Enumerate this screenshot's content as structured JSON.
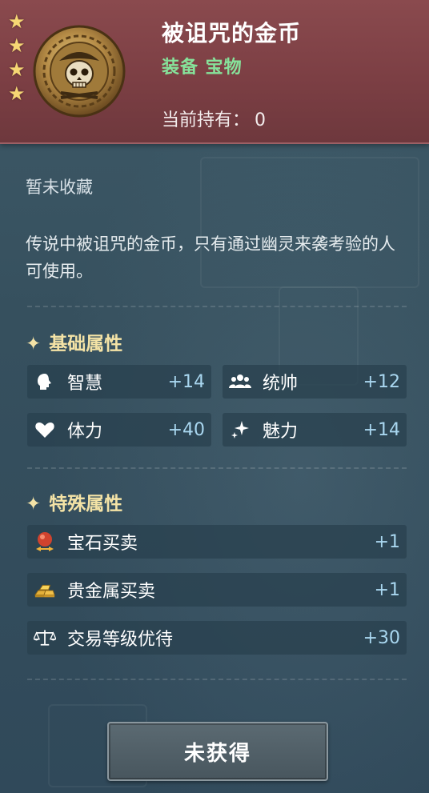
{
  "item": {
    "name": "被诅咒的金币",
    "category": "装备 宝物",
    "owned_label": "当前持有：",
    "owned_count": "0",
    "rarity_stars": 4,
    "rarity_color": "#f6d774"
  },
  "status": "暂未收藏",
  "description": "传说中被诅咒的金币，只有通过幽灵来袭考验的人可使用。",
  "basic": {
    "title": "基础属性",
    "stats": [
      {
        "icon": "head-icon",
        "name": "智慧",
        "value": "+14"
      },
      {
        "icon": "people-icon",
        "name": "统帅",
        "value": "+12"
      },
      {
        "icon": "heart-icon",
        "name": "体力",
        "value": "+40"
      },
      {
        "icon": "sparkle-icon",
        "name": "魅力",
        "value": "+14"
      }
    ]
  },
  "special": {
    "title": "特殊属性",
    "stats": [
      {
        "icon": "gem-trade-icon",
        "name": "宝石买卖",
        "value": "+1"
      },
      {
        "icon": "gold-bars-icon",
        "name": "贵金属买卖",
        "value": "+1"
      },
      {
        "icon": "scales-icon",
        "name": "交易等级优待",
        "value": "+30"
      }
    ]
  },
  "action_button": "未获得",
  "colors": {
    "header": "#7c3f44",
    "category": "#86e29a",
    "section_title": "#f4e3a6",
    "stat_value": "#a9d7f0"
  }
}
